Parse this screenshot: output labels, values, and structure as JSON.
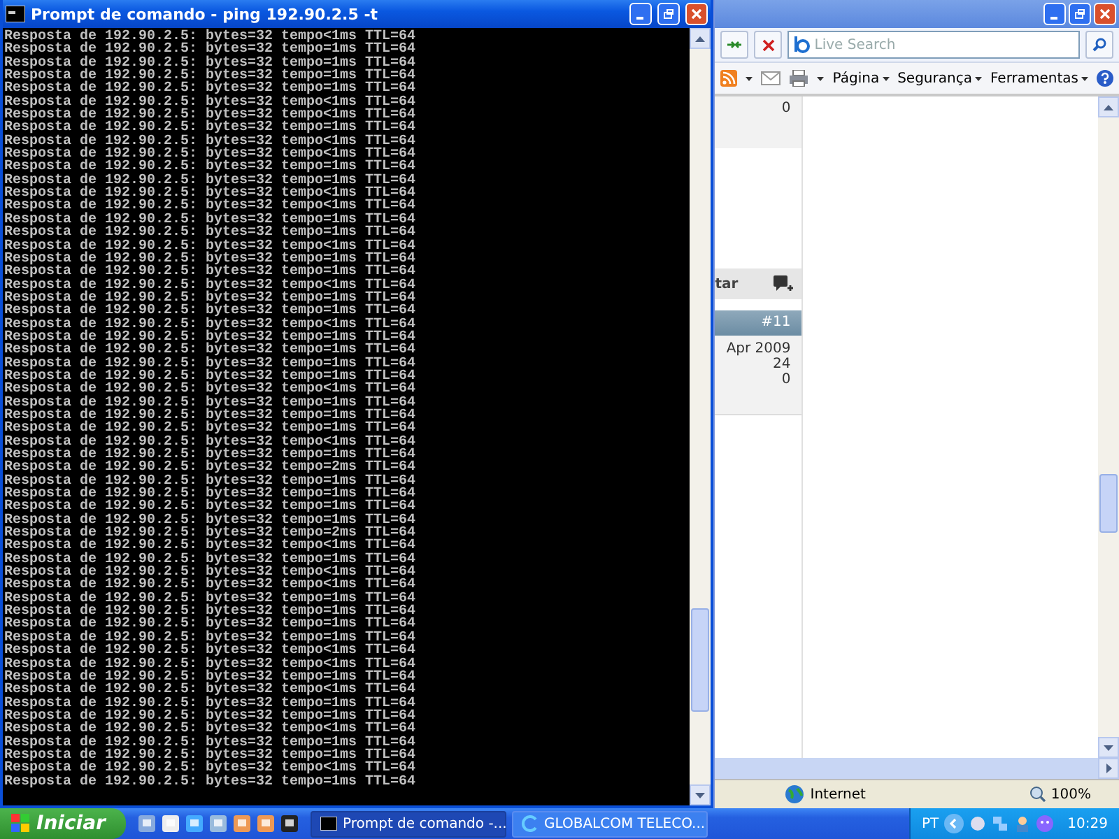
{
  "console": {
    "title": "Prompt de comando - ping 192.90.2.5 -t",
    "lines": [
      "Resposta de 192.90.2.5: bytes=32 tempo<1ms TTL=64",
      "Resposta de 192.90.2.5: bytes=32 tempo=1ms TTL=64",
      "Resposta de 192.90.2.5: bytes=32 tempo=1ms TTL=64",
      "Resposta de 192.90.2.5: bytes=32 tempo=1ms TTL=64",
      "Resposta de 192.90.2.5: bytes=32 tempo=1ms TTL=64",
      "Resposta de 192.90.2.5: bytes=32 tempo<1ms TTL=64",
      "Resposta de 192.90.2.5: bytes=32 tempo<1ms TTL=64",
      "Resposta de 192.90.2.5: bytes=32 tempo=1ms TTL=64",
      "Resposta de 192.90.2.5: bytes=32 tempo<1ms TTL=64",
      "Resposta de 192.90.2.5: bytes=32 tempo<1ms TTL=64",
      "Resposta de 192.90.2.5: bytes=32 tempo=1ms TTL=64",
      "Resposta de 192.90.2.5: bytes=32 tempo=1ms TTL=64",
      "Resposta de 192.90.2.5: bytes=32 tempo<1ms TTL=64",
      "Resposta de 192.90.2.5: bytes=32 tempo<1ms TTL=64",
      "Resposta de 192.90.2.5: bytes=32 tempo=1ms TTL=64",
      "Resposta de 192.90.2.5: bytes=32 tempo=1ms TTL=64",
      "Resposta de 192.90.2.5: bytes=32 tempo<1ms TTL=64",
      "Resposta de 192.90.2.5: bytes=32 tempo=1ms TTL=64",
      "Resposta de 192.90.2.5: bytes=32 tempo=1ms TTL=64",
      "Resposta de 192.90.2.5: bytes=32 tempo<1ms TTL=64",
      "Resposta de 192.90.2.5: bytes=32 tempo=1ms TTL=64",
      "Resposta de 192.90.2.5: bytes=32 tempo=1ms TTL=64",
      "Resposta de 192.90.2.5: bytes=32 tempo<1ms TTL=64",
      "Resposta de 192.90.2.5: bytes=32 tempo=1ms TTL=64",
      "Resposta de 192.90.2.5: bytes=32 tempo=1ms TTL=64",
      "Resposta de 192.90.2.5: bytes=32 tempo=1ms TTL=64",
      "Resposta de 192.90.2.5: bytes=32 tempo=1ms TTL=64",
      "Resposta de 192.90.2.5: bytes=32 tempo<1ms TTL=64",
      "Resposta de 192.90.2.5: bytes=32 tempo=1ms TTL=64",
      "Resposta de 192.90.2.5: bytes=32 tempo=1ms TTL=64",
      "Resposta de 192.90.2.5: bytes=32 tempo=1ms TTL=64",
      "Resposta de 192.90.2.5: bytes=32 tempo<1ms TTL=64",
      "Resposta de 192.90.2.5: bytes=32 tempo=1ms TTL=64",
      "Resposta de 192.90.2.5: bytes=32 tempo=2ms TTL=64",
      "Resposta de 192.90.2.5: bytes=32 tempo=1ms TTL=64",
      "Resposta de 192.90.2.5: bytes=32 tempo=1ms TTL=64",
      "Resposta de 192.90.2.5: bytes=32 tempo=1ms TTL=64",
      "Resposta de 192.90.2.5: bytes=32 tempo=1ms TTL=64",
      "Resposta de 192.90.2.5: bytes=32 tempo=2ms TTL=64",
      "Resposta de 192.90.2.5: bytes=32 tempo<1ms TTL=64",
      "Resposta de 192.90.2.5: bytes=32 tempo=1ms TTL=64",
      "Resposta de 192.90.2.5: bytes=32 tempo<1ms TTL=64",
      "Resposta de 192.90.2.5: bytes=32 tempo<1ms TTL=64",
      "Resposta de 192.90.2.5: bytes=32 tempo=1ms TTL=64",
      "Resposta de 192.90.2.5: bytes=32 tempo=1ms TTL=64",
      "Resposta de 192.90.2.5: bytes=32 tempo=1ms TTL=64",
      "Resposta de 192.90.2.5: bytes=32 tempo=1ms TTL=64",
      "Resposta de 192.90.2.5: bytes=32 tempo<1ms TTL=64",
      "Resposta de 192.90.2.5: bytes=32 tempo<1ms TTL=64",
      "Resposta de 192.90.2.5: bytes=32 tempo=1ms TTL=64",
      "Resposta de 192.90.2.5: bytes=32 tempo<1ms TTL=64",
      "Resposta de 192.90.2.5: bytes=32 tempo=1ms TTL=64",
      "Resposta de 192.90.2.5: bytes=32 tempo=1ms TTL=64",
      "Resposta de 192.90.2.5: bytes=32 tempo<1ms TTL=64",
      "Resposta de 192.90.2.5: bytes=32 tempo=1ms TTL=64",
      "Resposta de 192.90.2.5: bytes=32 tempo=1ms TTL=64",
      "Resposta de 192.90.2.5: bytes=32 tempo<1ms TTL=64",
      "Resposta de 192.90.2.5: bytes=32 tempo=1ms TTL=64"
    ]
  },
  "browser": {
    "search": {
      "placeholder": "Live Search"
    },
    "commands": [
      "Página",
      "Segurança",
      "Ferramentas"
    ],
    "content": {
      "top_count": "0",
      "toolbar_text": "tar",
      "post_number": "#11",
      "details": [
        "Apr 2009",
        "24",
        "0"
      ]
    },
    "status": {
      "zone": "Internet",
      "zoom": "100%"
    }
  },
  "taskbar": {
    "start": "Iniciar",
    "tasks": [
      {
        "label": "Prompt de comando -...",
        "selected": true,
        "kind": "console"
      },
      {
        "label": "GLOBALCOM TELECO...",
        "selected": false,
        "kind": "browser"
      }
    ],
    "language": "PT",
    "clock": "10:29"
  }
}
